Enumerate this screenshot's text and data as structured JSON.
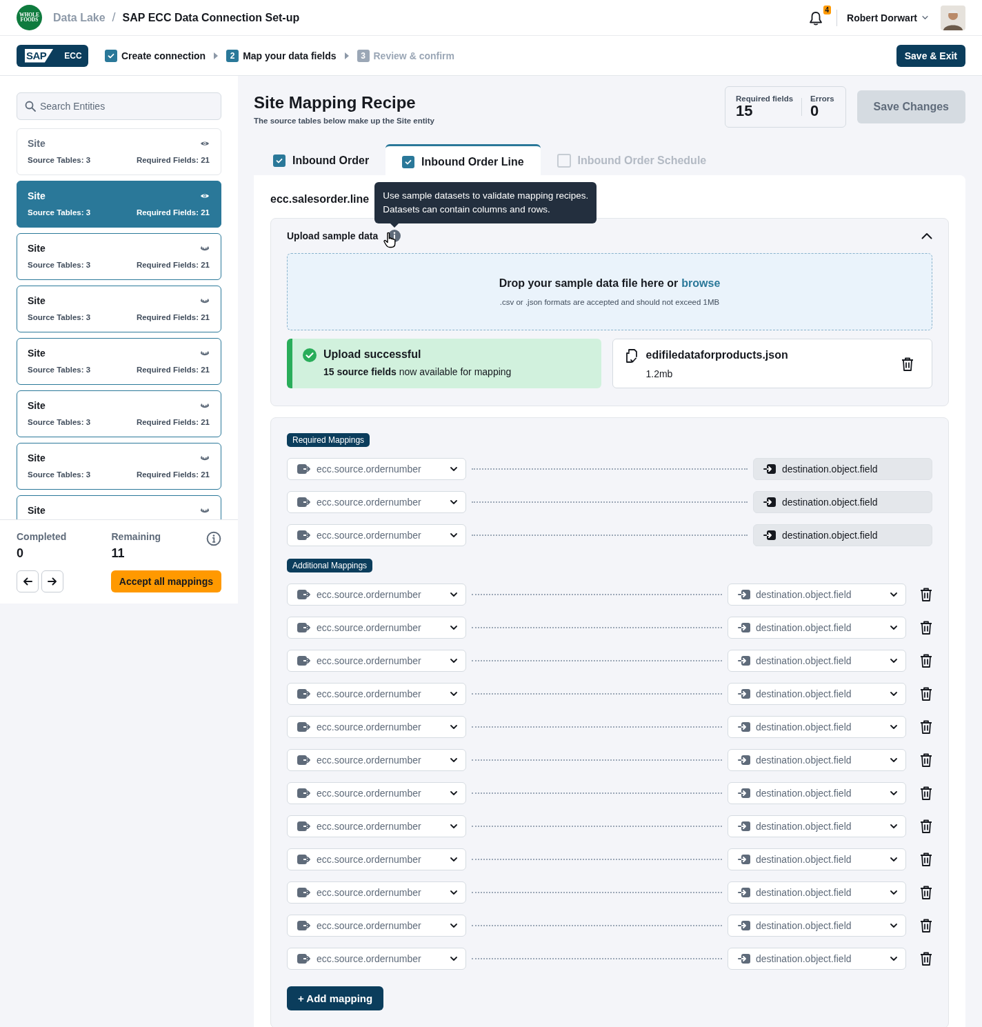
{
  "header": {
    "logo_lines": [
      "WHOLE",
      "FOODS"
    ],
    "breadcrumb": [
      {
        "label": "Data Lake",
        "current": false
      },
      {
        "label": "SAP ECC Data Connection Set-up",
        "current": true
      }
    ],
    "breadcrumb_separator": "/",
    "notifications": "4",
    "user": "Robert Dorwart"
  },
  "stepbar": {
    "source": {
      "logo": "SAP",
      "label": "ECC"
    },
    "steps": [
      {
        "label": "Create connection",
        "done": true,
        "current": false
      },
      {
        "number": "2",
        "label": "Map your data fields",
        "done": false,
        "current": true
      },
      {
        "number": "3",
        "label": "Review & confirm",
        "done": false,
        "current": false
      }
    ],
    "save_button": "Save & Exit"
  },
  "sidebar": {
    "search": {
      "placeholder": "Search Entities"
    },
    "entities": [
      {
        "name": "Site",
        "source_tables": "Source Tables: 3",
        "required_fields": "Required Fields: 21",
        "hidden": false,
        "selected": false
      },
      {
        "name": "Site",
        "source_tables": "Source Tables: 3",
        "required_fields": "Required Fields: 21",
        "hidden": false,
        "selected": true
      },
      {
        "name": "Site",
        "source_tables": "Source Tables: 3",
        "required_fields": "Required Fields: 21",
        "hidden": true,
        "selected": false
      },
      {
        "name": "Site",
        "source_tables": "Source Tables: 3",
        "required_fields": "Required Fields: 21",
        "hidden": true,
        "selected": false
      },
      {
        "name": "Site",
        "source_tables": "Source Tables: 3",
        "required_fields": "Required Fields: 21",
        "hidden": true,
        "selected": false
      },
      {
        "name": "Site",
        "source_tables": "Source Tables: 3",
        "required_fields": "Required Fields: 21",
        "hidden": true,
        "selected": false
      },
      {
        "name": "Site",
        "source_tables": "Source Tables: 3",
        "required_fields": "Required Fields: 21",
        "hidden": true,
        "selected": false
      },
      {
        "name": "Site",
        "hidden": true,
        "selected": false
      }
    ],
    "footer": {
      "completed_label": "Completed",
      "completed": "0",
      "remaining_label": "Remaining",
      "remaining": "11",
      "accept_button": "Accept all mappings"
    }
  },
  "main": {
    "title": "Site Mapping Recipe",
    "subtitle": "The source tables below make up the Site entity",
    "stats": [
      {
        "label": "Required fields",
        "value": "15"
      },
      {
        "label": "Errors",
        "value": "0"
      }
    ],
    "save_changes": {
      "label": "Save Changes",
      "disabled": true
    },
    "tabs": [
      {
        "label": "Inbound Order",
        "checked": true,
        "selected": false,
        "disabled": false
      },
      {
        "label": "Inbound Order Line",
        "checked": true,
        "selected": true,
        "disabled": false
      },
      {
        "label": "Inbound Order Schedule",
        "checked": false,
        "selected": false,
        "disabled": true
      }
    ],
    "table_name": "ecc.salesorder.line",
    "upload": {
      "title": "Upload sample data",
      "expanded": true,
      "tooltip": "Use sample datasets to validate mapping recipes. Datasets can contain columns and rows.",
      "dropzone": {
        "text": "Drop your sample data file here or",
        "link": "browse",
        "hint": ".csv or .json formats are accepted and should not exceed 1MB"
      },
      "status": {
        "title": "Upload successful",
        "message": "**15 source fields** now available for mapping"
      },
      "file": {
        "name": "edifiledataforproducts.json",
        "size": "1.2mb"
      }
    },
    "mappings": {
      "required": {
        "label": "Required Mappings",
        "rows": [
          {
            "source": "ecc.source.ordernumber",
            "destination": "destination.object.field"
          },
          {
            "source": "ecc.source.ordernumber",
            "destination": "destination.object.field"
          },
          {
            "source": "ecc.source.ordernumber",
            "destination": "destination.object.field"
          }
        ]
      },
      "additional": {
        "label": "Additional Mappings",
        "rows": [
          {
            "source": "ecc.source.ordernumber",
            "destination": "destination.object.field"
          },
          {
            "source": "ecc.source.ordernumber",
            "destination": "destination.object.field"
          },
          {
            "source": "ecc.source.ordernumber",
            "destination": "destination.object.field"
          },
          {
            "source": "ecc.source.ordernumber",
            "destination": "destination.object.field"
          },
          {
            "source": "ecc.source.ordernumber",
            "destination": "destination.object.field"
          },
          {
            "source": "ecc.source.ordernumber",
            "destination": "destination.object.field"
          },
          {
            "source": "ecc.source.ordernumber",
            "destination": "destination.object.field"
          },
          {
            "source": "ecc.source.ordernumber",
            "destination": "destination.object.field"
          },
          {
            "source": "ecc.source.ordernumber",
            "destination": "destination.object.field"
          },
          {
            "source": "ecc.source.ordernumber",
            "destination": "destination.object.field"
          },
          {
            "source": "ecc.source.ordernumber",
            "destination": "destination.object.field"
          },
          {
            "source": "ecc.source.ordernumber",
            "destination": "destination.object.field"
          }
        ]
      },
      "add_button": "+ Add mapping"
    }
  }
}
